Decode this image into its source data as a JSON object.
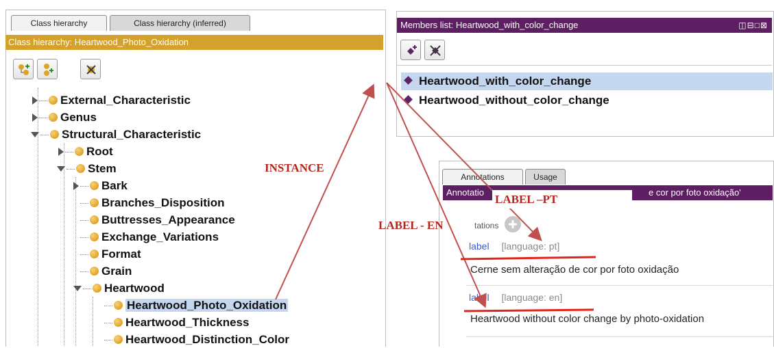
{
  "left_panel": {
    "tabs": [
      {
        "label": "Class hierarchy",
        "active": true
      },
      {
        "label": "Class hierarchy (inferred)",
        "active": false
      }
    ],
    "header": "Class hierarchy: Heartwood_Photo_Oxidation",
    "header_color": "#d4a12c",
    "toolbar": [
      "add-subclass-icon",
      "add-sibling-class-icon",
      "delete-class-icon"
    ],
    "tree": [
      {
        "label": "External_Characteristic",
        "expander": "right"
      },
      {
        "label": "Genus",
        "expander": "right"
      },
      {
        "label": "Structural_Characteristic",
        "expander": "down"
      },
      {
        "label": "Root",
        "expander": "right"
      },
      {
        "label": "Stem",
        "expander": "down"
      },
      {
        "label": "Bark",
        "expander": "right"
      },
      {
        "label": "Branches_Disposition",
        "expander": "none"
      },
      {
        "label": "Buttresses_Appearance",
        "expander": "none"
      },
      {
        "label": "Exchange_Variations",
        "expander": "none"
      },
      {
        "label": "Format",
        "expander": "none"
      },
      {
        "label": "Grain",
        "expander": "none"
      },
      {
        "label": "Heartwood",
        "expander": "down"
      },
      {
        "label": "Heartwood_Photo_Oxidation",
        "expander": "none",
        "selected": true
      },
      {
        "label": "Heartwood_Thickness",
        "expander": "none"
      },
      {
        "label": "Heartwood_Distinction_Color",
        "expander": "none"
      }
    ]
  },
  "members_panel": {
    "title": "Members list: Heartwood_with_color_change",
    "title_color": "#5d1f61",
    "window_controls": "◫⊟□⊠",
    "toolbar": [
      "add-individual-icon",
      "delete-individual-icon"
    ],
    "members": [
      {
        "label": "Heartwood_with_color_change",
        "selected": true
      },
      {
        "label": "Heartwood_without_color_change",
        "selected": false
      }
    ]
  },
  "annotations_panel": {
    "tabs": [
      {
        "label": "Annotations",
        "active": true
      },
      {
        "label": "Usage",
        "active": false
      }
    ],
    "header_left": "Annotatio",
    "header_right": "e cor por foto oxidação'",
    "add_row_label": "tations",
    "annotations": [
      {
        "property": "label",
        "language": "[language: pt]",
        "value": "Cerne sem alteração de cor por foto oxidação"
      },
      {
        "property": "label",
        "language": "[language: en]",
        "value": "Heartwood without color change by photo-oxidation"
      }
    ]
  },
  "overlay": {
    "instance_label": "INSTANCE",
    "label_pt": "LABEL –PT",
    "label_en": "LABEL - EN",
    "arrow_color": "#c0504d",
    "underline_color": "#e2231a"
  }
}
